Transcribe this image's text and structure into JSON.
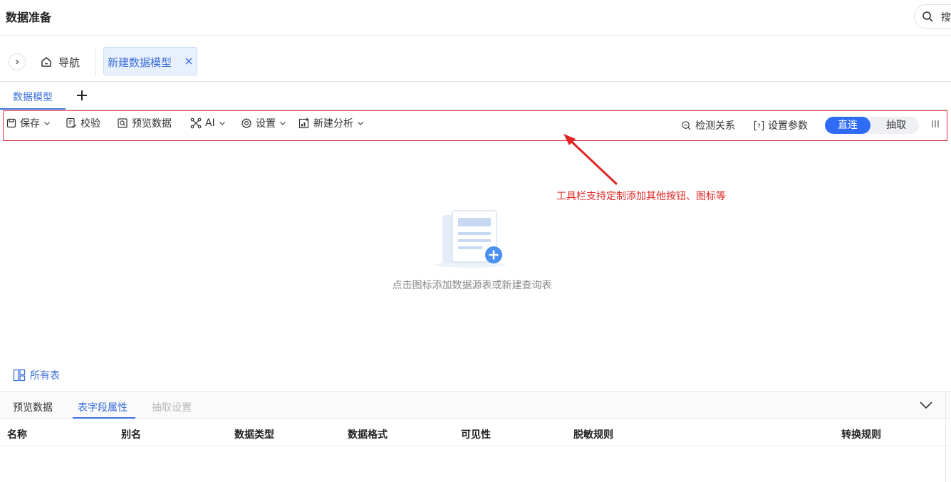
{
  "header": {
    "title": "数据准备",
    "search_label": "搜"
  },
  "tabbar": {
    "nav_label": "导航",
    "open_tab_label": "新建数据模型"
  },
  "model_tabs": {
    "active_label": "数据模型"
  },
  "toolbar": {
    "save": "保存",
    "validate": "校验",
    "preview": "预览数据",
    "ai": "AI",
    "settings": "设置",
    "new_analysis": "新建分析",
    "detect_relations": "检测关系",
    "set_params": "设置参数",
    "mode_direct": "直连",
    "mode_extract": "抽取"
  },
  "annotation": {
    "text": "工具栏支持定制添加其他按钮、图标等",
    "color": "#e02424"
  },
  "canvas": {
    "empty_text": "点击图标添加数据源表或新建查询表"
  },
  "all_tables_label": "所有表",
  "bottom_panel": {
    "tabs": [
      "预览数据",
      "表字段属性",
      "抽取设置"
    ],
    "active_tab": "表字段属性",
    "columns": [
      "名称",
      "别名",
      "数据类型",
      "数据格式",
      "可见性",
      "脱敏规则",
      "转换规则"
    ]
  },
  "colors": {
    "accent": "#3b6fd8",
    "toggle_active": "#2f6cf6",
    "highlight_border": "#e0343a"
  },
  "icons": {
    "search": "search-icon",
    "home": "home-icon",
    "close": "close-icon",
    "chevron_down": "chevron-down-icon",
    "more": "more-icon"
  }
}
